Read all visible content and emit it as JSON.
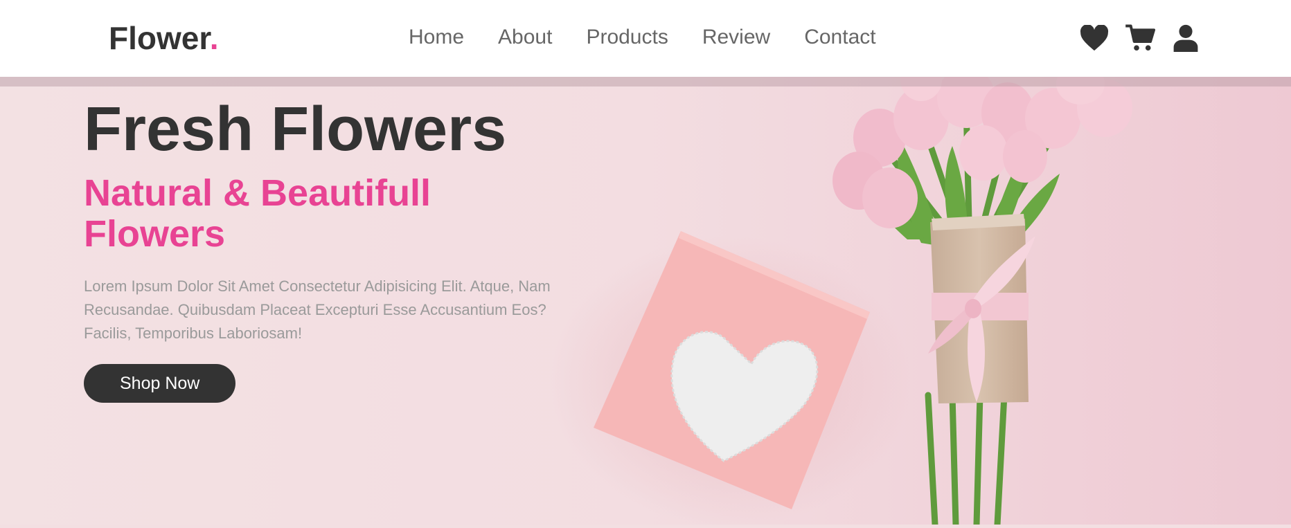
{
  "header": {
    "logo_text": "Flower",
    "logo_dot": ".",
    "nav": [
      "Home",
      "About",
      "Products",
      "Review",
      "Contact"
    ],
    "icons": [
      "heart-icon",
      "cart-icon",
      "user-icon"
    ]
  },
  "hero": {
    "title": "Fresh Flowers",
    "subtitle": "Natural & Beautifull Flowers",
    "description": "Lorem Ipsum Dolor Sit Amet Consectetur Adipisicing Elit. Atque, Nam Recusandae. Quibusdam Placeat Excepturi Esse Accusantium Eos? Facilis, Temporibus Laboriosam!",
    "button_label": "Shop Now"
  },
  "colors": {
    "accent": "#e84393",
    "dark": "#333333",
    "muted_text": "#9a9a9a",
    "hero_bg": "#f3dfe2"
  }
}
